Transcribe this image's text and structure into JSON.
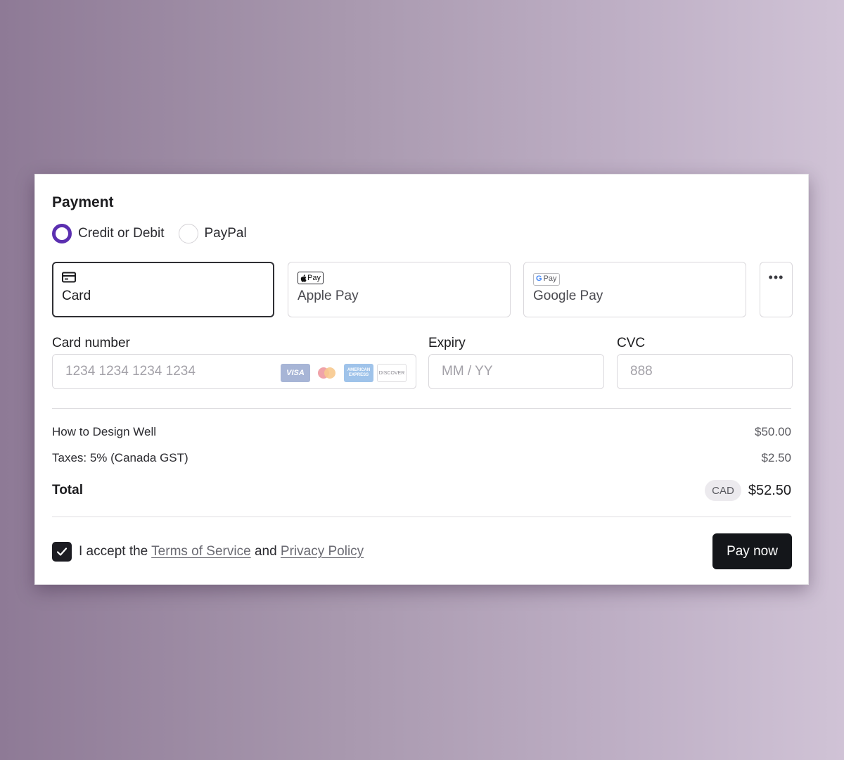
{
  "payment": {
    "title": "Payment",
    "radio_options": [
      {
        "label": "Credit or Debit",
        "checked": true
      },
      {
        "label": "PayPal",
        "checked": false
      }
    ],
    "methods": [
      {
        "label": "Card",
        "icon": "credit-card-icon",
        "selected": true
      },
      {
        "label": "Apple Pay",
        "icon": "apple-pay-icon",
        "badge": "Pay",
        "selected": false
      },
      {
        "label": "Google Pay",
        "icon": "google-pay-icon",
        "badge": "Pay",
        "selected": false
      }
    ],
    "more_icon": "more-dots-icon",
    "fields": {
      "card_number": {
        "label": "Card number",
        "placeholder": "1234 1234 1234 1234"
      },
      "expiry": {
        "label": "Expiry",
        "placeholder": "MM / YY"
      },
      "cvc": {
        "label": "CVC",
        "placeholder": "888"
      }
    },
    "card_brands": [
      "VISA",
      "mastercard",
      "AMERICAN EXPRESS",
      "DISCOVER"
    ],
    "summary": {
      "items": [
        {
          "label": "How to Design Well",
          "value": "$50.00"
        },
        {
          "label": "Taxes: 5% (Canada GST)",
          "value": "$2.50"
        }
      ],
      "total_label": "Total",
      "currency": "CAD",
      "total_value": "$52.50"
    },
    "terms": {
      "prefix": "I accept the",
      "tos": "Terms of Service",
      "and": "and",
      "privacy": "Privacy Policy",
      "checked": true
    },
    "pay_button": "Pay now",
    "colors": {
      "accent": "#5b2fb0",
      "button": "#14161a"
    }
  }
}
